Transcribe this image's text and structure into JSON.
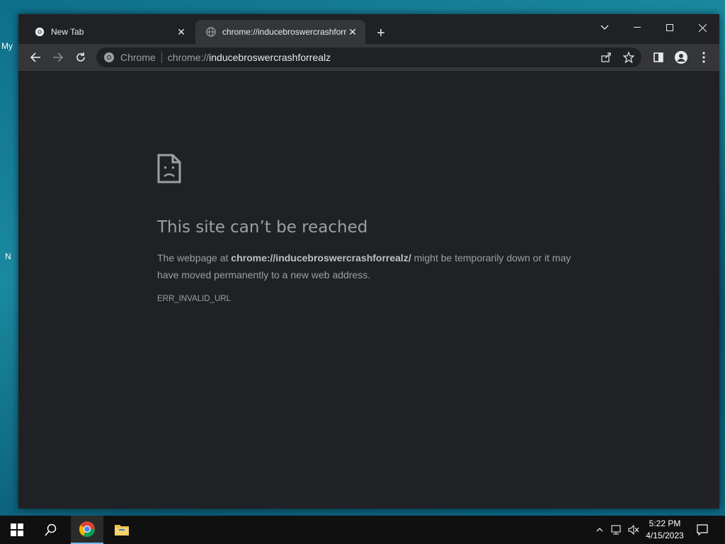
{
  "desktop": {
    "frag1": "My",
    "frag2": "N"
  },
  "window": {
    "tabs": [
      {
        "title": "New Tab",
        "active": false
      },
      {
        "title": "chrome://inducebroswercrashforrealz/",
        "active": true
      }
    ],
    "new_tab_symbol": "+",
    "controls": {
      "tab_search": "chevron-down-icon",
      "minimize": "minimize-icon",
      "maximize": "maximize-icon",
      "close": "close-icon"
    }
  },
  "toolbar": {
    "back": "back-arrow-icon",
    "forward": "forward-arrow-icon",
    "reload": "reload-icon",
    "omnibox": {
      "chip_label": "Chrome",
      "url_scheme": "chrome://",
      "url_host": "inducebroswercrashforrealz"
    },
    "actions": [
      "share-icon",
      "star-icon",
      "side-panel-icon",
      "profile-icon",
      "menu-kebab-icon"
    ]
  },
  "error_page": {
    "title": "This site can’t be reached",
    "body_prefix": "The webpage at ",
    "body_url": "chrome://inducebroswercrashforrealz/",
    "body_suffix": " might be temporarily down or it may have moved permanently to a new web address.",
    "error_code": "ERR_INVALID_URL"
  },
  "taskbar": {
    "items": [
      "windows-start-icon",
      "search-icon",
      "chrome-icon",
      "file-explorer-icon"
    ],
    "active_item": "chrome-icon",
    "time": "5:22 PM",
    "date": "4/15/2023"
  },
  "colors": {
    "window_bg": "#202124",
    "toolbar_bg": "#35363a",
    "text_secondary": "#9aa0a6"
  }
}
